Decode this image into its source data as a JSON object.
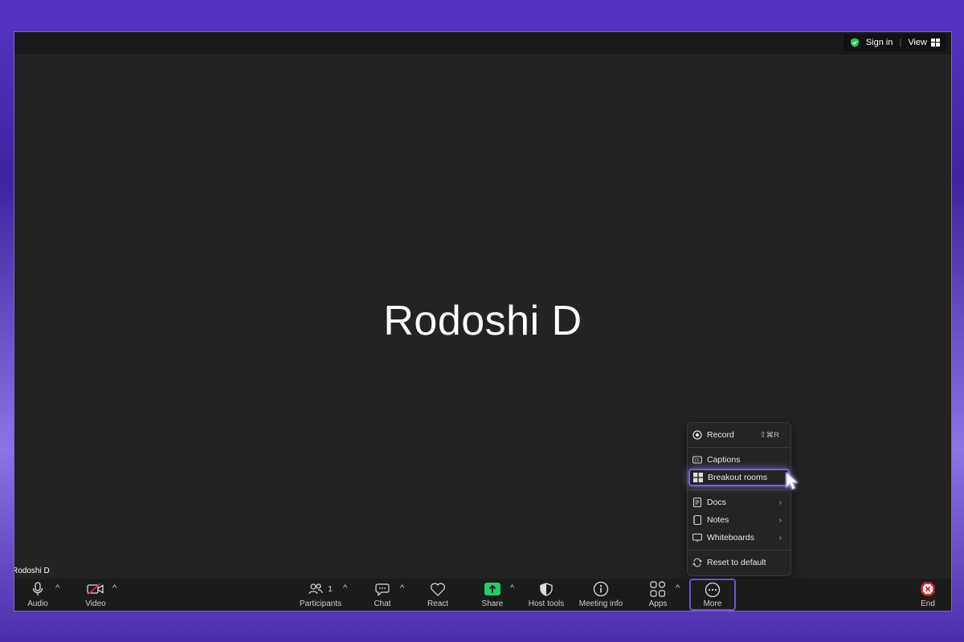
{
  "topbar": {
    "sign_in": "Sign in",
    "separator": "|",
    "view": "View"
  },
  "main": {
    "participant_name": "Rodoshi D",
    "name_tag": "Rodoshi D"
  },
  "toolbar": {
    "audio": "Audio",
    "video": "Video",
    "participants": "Participants",
    "participants_count": "1",
    "chat": "Chat",
    "react": "React",
    "share": "Share",
    "host_tools": "Host tools",
    "meeting_info": "Meeting info",
    "apps": "Apps",
    "more": "More",
    "end": "End",
    "caret": "^"
  },
  "more_menu": {
    "record": "Record",
    "record_shortcut": "⇧⌘R",
    "captions": "Captions",
    "breakout_rooms": "Breakout rooms",
    "docs": "Docs",
    "notes": "Notes",
    "whiteboards": "Whiteboards",
    "reset": "Reset to default",
    "chevron": "›"
  },
  "colors": {
    "accent": "#6b53d6",
    "share_green": "#1fce6b",
    "end_red": "#e0243b",
    "security_green": "#22c55e"
  }
}
